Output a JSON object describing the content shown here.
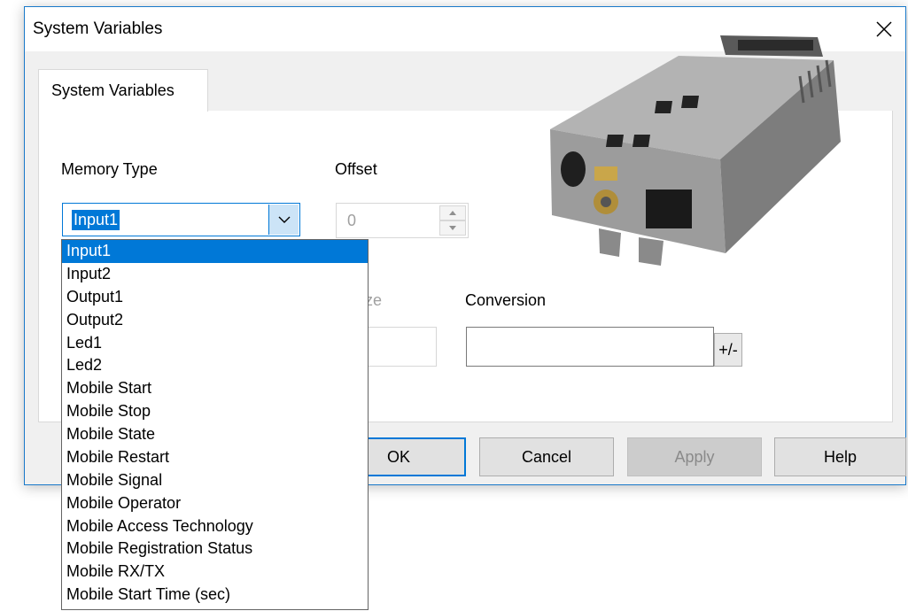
{
  "dialog": {
    "title": "System Variables",
    "tab_label": "System Variables",
    "memory_type_label": "Memory Type",
    "memory_type_value": "Input1",
    "offset_label": "Offset",
    "offset_value": "0",
    "size_label_partial": "ze",
    "conversion_label": "Conversion",
    "conversion_value": "",
    "plus_minus_label": "+/-",
    "buttons": {
      "ok": "OK",
      "cancel": "Cancel",
      "apply": "Apply",
      "help": "Help"
    }
  },
  "dropdown": {
    "selected_index": 0,
    "items": [
      "Input1",
      "Input2",
      "Output1",
      "Output2",
      "Led1",
      "Led2",
      "Mobile Start",
      "Mobile Stop",
      "Mobile State",
      "Mobile Restart",
      "Mobile Signal",
      "Mobile Operator",
      "Mobile Access Technology",
      "Mobile Registration Status",
      "Mobile RX/TX",
      "Mobile Start Time (sec)"
    ]
  },
  "icons": {
    "close": "close-icon",
    "combo_arrow": "chevron-down-icon",
    "spin_up": "triangle-up-icon",
    "spin_down": "triangle-down-icon",
    "device_image": "device-image"
  },
  "colors": {
    "accent": "#0078d7",
    "dialog_bg": "#f0f0f0",
    "panel_bg": "#ffffff",
    "disabled_text": "#a0a0a0"
  }
}
